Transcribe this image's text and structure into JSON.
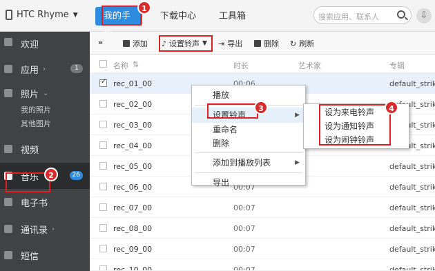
{
  "topbar": {
    "device": "HTC Rhyme",
    "tabs": [
      "我的手机",
      "下载中心",
      "工具箱"
    ],
    "search_placeholder": "搜索应用、联系人"
  },
  "sidebar": {
    "items": [
      {
        "label": "欢迎"
      },
      {
        "label": "应用",
        "badge": "1"
      },
      {
        "label": "照片"
      },
      {
        "label": "我的照片"
      },
      {
        "label": "其他图片"
      },
      {
        "label": "视频"
      },
      {
        "label": "音乐",
        "badge": "26"
      },
      {
        "label": "电子书"
      },
      {
        "label": "通讯录"
      },
      {
        "label": "短信"
      }
    ]
  },
  "toolbar": {
    "collapse": "»",
    "add": "添加",
    "ringtone": "设置铃声",
    "export": "导出",
    "delete": "删除",
    "refresh": "刷新"
  },
  "table": {
    "headers": {
      "name": "名称",
      "time": "时长",
      "artist": "艺术家",
      "album": "专辑"
    },
    "rows": [
      {
        "name": "rec_01_00",
        "time": "00:06",
        "album": "default_strike"
      },
      {
        "name": "rec_02_00",
        "time": "",
        "album": "default_strike"
      },
      {
        "name": "rec_03_00",
        "time": "",
        "album": "default_strike"
      },
      {
        "name": "rec_04_00",
        "time": "",
        "album": "default_strike"
      },
      {
        "name": "rec_05_00",
        "time": "",
        "album": "default_strike"
      },
      {
        "name": "rec_06_00",
        "time": "00:07",
        "album": "default_strike"
      },
      {
        "name": "rec_07_00",
        "time": "00:07",
        "album": "default_strike"
      },
      {
        "name": "rec_08_00",
        "time": "00:07",
        "album": "default_strike"
      },
      {
        "name": "rec_09_00",
        "time": "00:07",
        "album": "default_strike"
      },
      {
        "name": "rec_10_00",
        "time": "00:07",
        "album": "default_strike"
      }
    ]
  },
  "context_menu": {
    "items": [
      "播放",
      "设置铃声",
      "重命名",
      "删除",
      "添加到播放列表",
      "导出"
    ]
  },
  "submenu": {
    "items": [
      "设为来电铃声",
      "设为通知铃声",
      "设为闹钟铃声"
    ]
  },
  "annotations": [
    "1",
    "2",
    "3",
    "4"
  ],
  "colors": {
    "accent": "#2d8be0",
    "highlight": "#e02020",
    "sidebar": "#414244"
  }
}
